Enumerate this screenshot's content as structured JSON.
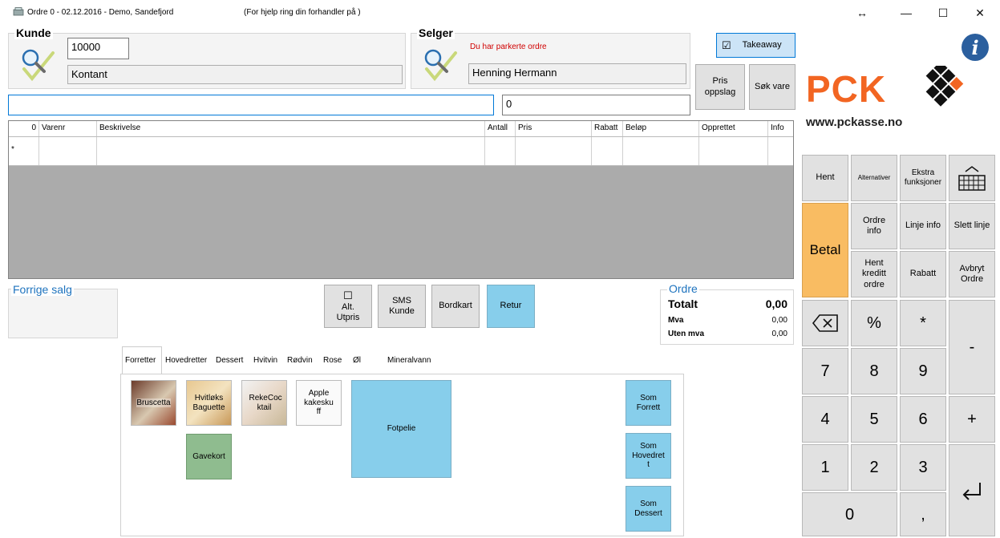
{
  "window": {
    "title": "Ordre 0 - 02.12.2016 - Demo, Sandefjord",
    "help_text": "(For hjelp ring din forhandler  på )",
    "restore_glyph": "↔",
    "minimize_glyph": "—",
    "maximize_glyph": "☐",
    "close_glyph": "✕"
  },
  "customer": {
    "label": "Kunde",
    "number": "10000",
    "name": "Kontant"
  },
  "seller": {
    "label": "Selger",
    "parked_notice": "Du har parkerte ordre",
    "name": "Henning Hermann"
  },
  "takeaway": {
    "label": "Takeaway",
    "checked": true,
    "check_glyph": "☑"
  },
  "price_lookup_button": "Pris oppslag",
  "search_item_button": "Søk vare",
  "info_icon_glyph": "i",
  "logo": {
    "brand": "PCK",
    "url": "www.pckasse.no"
  },
  "search": {
    "value": "",
    "quantity": "0"
  },
  "order_grid": {
    "columns": [
      "0",
      "Varenr",
      "Beskrivelse",
      "Antall",
      "Pris",
      "Rabatt",
      "Beløp",
      "Opprettet",
      "Info"
    ],
    "new_row_marker": "*"
  },
  "previous_sales": {
    "label": "Forrige salg"
  },
  "mid_buttons": {
    "alt_price_check": "☐",
    "alt_price": "Alt. Utpris",
    "sms_customer": "SMS Kunde",
    "table_map": "Bordkart",
    "return": "Retur"
  },
  "order_summary": {
    "label": "Ordre",
    "total_label": "Totalt",
    "total_value": "0,00",
    "vat_label": "Mva",
    "vat_value": "0,00",
    "ex_vat_label": "Uten mva",
    "ex_vat_value": "0,00"
  },
  "tabs": [
    "Forretter",
    "Hovedretter",
    "Dessert",
    "Hvitvin",
    "Rødvin",
    "Rose",
    "Øl",
    "Mineralvann"
  ],
  "menu_items": {
    "bruschetta": "Bruscetta",
    "garlic_baguette": "Hvitløks Baguette",
    "shrimp_cocktail": "RekeCoc ktail",
    "apple_cake": "Apple kakesku ff",
    "gift_card": "Gavekort",
    "fotpelie": "Fotpelie",
    "as_starter": "Som Forrett",
    "as_main": "Som Hovedret t",
    "as_dessert": "Som Dessert"
  },
  "keypad": {
    "fetch": "Hent",
    "alternatives": "Alternativer",
    "extra_functions": "Ekstra funksjoner",
    "keyboard_glyph": "⌨",
    "pay": "Betal",
    "order_info": "Ordre info",
    "line_info": "Linje info",
    "delete_line": "Slett linje",
    "fetch_credit_order": "Hent kreditt ordre",
    "discount": "Rabatt",
    "cancel_order": "Avbryt Ordre",
    "backspace_glyph": "⌫",
    "percent": "%",
    "multiply": "*",
    "minus": "-",
    "plus": "+",
    "enter_glyph": "↵",
    "digits": [
      "7",
      "8",
      "9",
      "4",
      "5",
      "6",
      "1",
      "2",
      "3"
    ],
    "zero": "0",
    "comma": ","
  },
  "colors": {
    "accent_blue": "#87ceeb",
    "pay_orange": "#f9bc62",
    "gift_green": "#8fbc8f",
    "logo_orange": "#f26522",
    "label_blue": "#1e73be",
    "notice_red": "#d00000"
  }
}
